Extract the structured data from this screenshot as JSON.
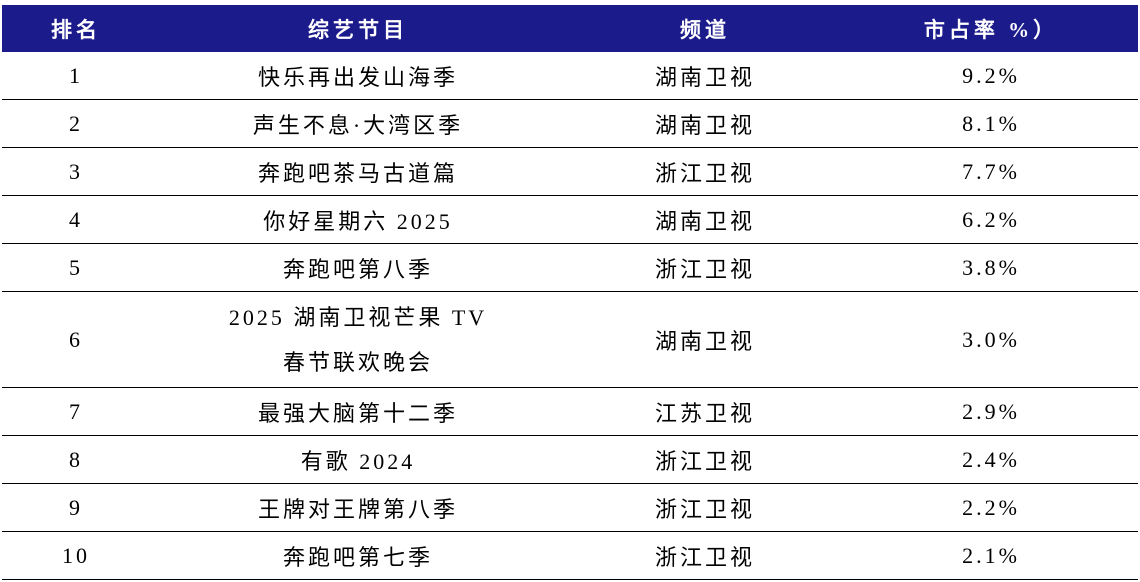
{
  "colors": {
    "header_bg": "#1c1b8c",
    "header_text": "#ffffff",
    "rule": "#000000"
  },
  "table": {
    "header": {
      "rank": "排名",
      "program": "综艺节目",
      "channel": "频道",
      "share": "市占率 %）"
    },
    "rows": [
      {
        "rank": "1",
        "program": "快乐再出发山海季",
        "channel": "湖南卫视",
        "share": "9.2%"
      },
      {
        "rank": "2",
        "program": "声生不息·大湾区季",
        "channel": "湖南卫视",
        "share": "8.1%"
      },
      {
        "rank": "3",
        "program": "奔跑吧茶马古道篇",
        "channel": "浙江卫视",
        "share": "7.7%"
      },
      {
        "rank": "4",
        "program": "你好星期六 2025",
        "channel": "湖南卫视",
        "share": "6.2%"
      },
      {
        "rank": "5",
        "program": "奔跑吧第八季",
        "channel": "浙江卫视",
        "share": "3.8%"
      },
      {
        "rank": "6",
        "program_lines": [
          "2025 湖南卫视芒果 TV",
          "春节联欢晚会"
        ],
        "channel": "湖南卫视",
        "share": "3.0%"
      },
      {
        "rank": "7",
        "program": "最强大脑第十二季",
        "channel": "江苏卫视",
        "share": "2.9%"
      },
      {
        "rank": "8",
        "program": "有歌 2024",
        "channel": "浙江卫视",
        "share": "2.4%"
      },
      {
        "rank": "9",
        "program": "王牌对王牌第八季",
        "channel": "浙江卫视",
        "share": "2.2%"
      },
      {
        "rank": "10",
        "program": "奔跑吧第七季",
        "channel": "浙江卫视",
        "share": "2.1%"
      }
    ]
  }
}
